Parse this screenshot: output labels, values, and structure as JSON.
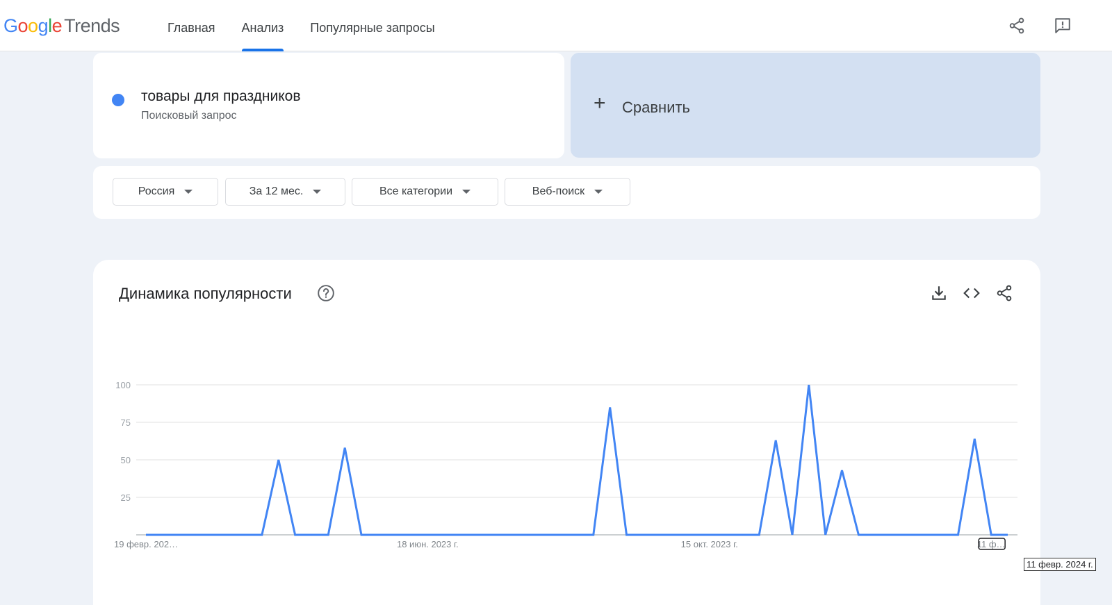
{
  "app": {
    "logo_google": "Google",
    "logo_trends": "Trends"
  },
  "nav": {
    "tabs": [
      {
        "label": "Главная",
        "active": false
      },
      {
        "label": "Анализ",
        "active": true
      },
      {
        "label": "Популярные запросы",
        "active": false
      }
    ]
  },
  "header_icons": [
    "share-icon",
    "feedback-icon"
  ],
  "search_term": {
    "name": "товары для праздников",
    "type": "Поисковый запрос",
    "color": "#4285f4"
  },
  "compare": {
    "plus": "+",
    "label": "Сравнить"
  },
  "filters": [
    {
      "label": "Россия"
    },
    {
      "label": "За 12 мес."
    },
    {
      "label": "Все категории"
    },
    {
      "label": "Веб-поиск"
    }
  ],
  "chart_section": {
    "title": "Динамика популярности",
    "actions": [
      "download-icon",
      "embed-icon",
      "share-icon"
    ]
  },
  "tooltip": {
    "text": "11 февр. 2024 г."
  },
  "chart_data": {
    "type": "line",
    "title": "",
    "xlabel": "",
    "ylabel": "",
    "ylim": [
      0,
      100
    ],
    "yticks": [
      25,
      50,
      75,
      100
    ],
    "grid": true,
    "line_color": "#4285f4",
    "x_ticks": [
      {
        "label": "19 февр. 202…",
        "index": 0
      },
      {
        "label": "18 июн. 2023 г.",
        "index": 17
      },
      {
        "label": "15 окт. 2023 г.",
        "index": 34
      },
      {
        "label": "11 ф…",
        "index": 51
      }
    ],
    "series": [
      {
        "values": [
          0,
          0,
          0,
          0,
          0,
          0,
          0,
          0,
          50,
          0,
          0,
          0,
          58,
          0,
          0,
          0,
          0,
          0,
          0,
          0,
          0,
          0,
          0,
          0,
          0,
          0,
          0,
          0,
          85,
          0,
          0,
          0,
          0,
          0,
          0,
          0,
          0,
          0,
          63,
          0,
          100,
          0,
          43,
          0,
          0,
          0,
          0,
          0,
          0,
          0,
          64,
          0,
          0
        ]
      }
    ]
  }
}
